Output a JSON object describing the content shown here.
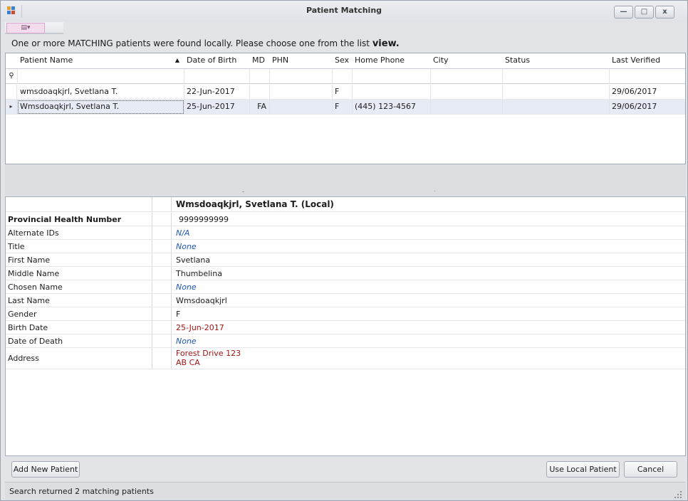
{
  "window": {
    "title": "Patient Matching",
    "minimize_label": "—",
    "maximize_label": "□",
    "close_label": "x"
  },
  "layout_button_label": "▤▾",
  "prompt": {
    "text": "One or more MATCHING patients were found locally.  Please choose one from the list",
    "emphasis": "view."
  },
  "grid": {
    "columns": [
      "Patient Name",
      "Date of Birth",
      "MD",
      "PHN",
      "Sex",
      "Home Phone",
      "City",
      "Status",
      "Last Verified"
    ],
    "sort_indicator": "▲",
    "filter_icon": "filter-pin-icon",
    "filter_glyph": "⚲",
    "current_row_glyph": "▸",
    "rows": [
      {
        "name": "wmsdoaqkjrl, Svetlana T.",
        "dob": "22-Jun-2017",
        "md": "",
        "phn": "",
        "sex": "F",
        "phone": "",
        "city": "",
        "status": "",
        "verified": "29/06/2017"
      },
      {
        "name": "Wmsdoaqkjrl, Svetlana T.",
        "dob": "25-Jun-2017",
        "md": "FA",
        "phn": "",
        "sex": "F",
        "phone": "(445) 123-4567",
        "city": "",
        "status": "",
        "verified": "29/06/2017"
      }
    ]
  },
  "detail": {
    "header": "Wmsdoaqkjrl, Svetlana T. (Local)",
    "fields": [
      {
        "label": "Provincial Health Number",
        "value": "9999999999",
        "style": "bold"
      },
      {
        "label": "Alternate IDs",
        "value": "N/A",
        "style": "none"
      },
      {
        "label": "Title",
        "value": "None",
        "style": "none"
      },
      {
        "label": "First Name",
        "value": "Svetlana",
        "style": "normal"
      },
      {
        "label": "Middle Name",
        "value": "Thumbelina",
        "style": "normal"
      },
      {
        "label": "Chosen Name",
        "value": "None",
        "style": "none"
      },
      {
        "label": "Last Name",
        "value": "Wmsdoaqkjrl",
        "style": "normal"
      },
      {
        "label": "Gender",
        "value": "F",
        "style": "normal"
      },
      {
        "label": "Birth Date",
        "value": "25-Jun-2017",
        "style": "red"
      },
      {
        "label": "Date of Death",
        "value": "None",
        "style": "none"
      },
      {
        "label": "Address",
        "value_line1": "Forest Drive 123",
        "value_line2": "AB CA",
        "style": "red"
      }
    ]
  },
  "buttons": {
    "add_new": "Add New Patient",
    "use_local": "Use Local Patient",
    "cancel": "Cancel"
  },
  "status": "Search returned 2 matching patients",
  "colors": {
    "selected_row": "#e7ebf5",
    "none_value": "#1f56b8",
    "red_value": "#a31414"
  }
}
